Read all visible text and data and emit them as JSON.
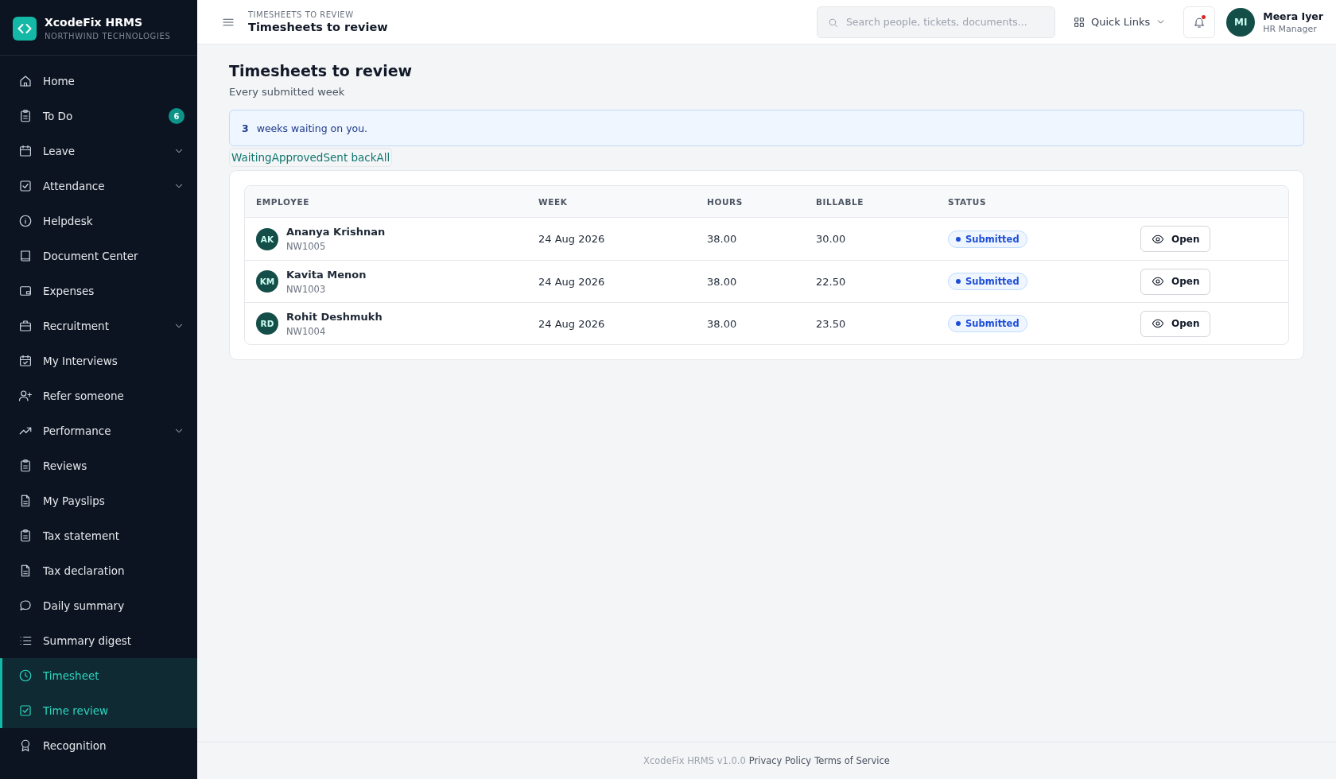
{
  "brand": {
    "name": "XcodeFix HRMS",
    "org": "NORTHWIND TECHNOLOGIES"
  },
  "sidebar": {
    "items": [
      {
        "label": "Home",
        "selected": false
      },
      {
        "label": "To Do",
        "selected": false,
        "badge": "6"
      },
      {
        "label": "Leave",
        "selected": false,
        "expandable": true
      },
      {
        "label": "Attendance",
        "selected": false,
        "expandable": true
      },
      {
        "label": "Helpdesk",
        "selected": false
      },
      {
        "label": "Document Center",
        "selected": false
      },
      {
        "label": "Expenses",
        "selected": false
      },
      {
        "label": "Recruitment",
        "selected": false,
        "expandable": true
      },
      {
        "label": "My Interviews",
        "selected": false
      },
      {
        "label": "Refer someone",
        "selected": false
      },
      {
        "label": "Performance",
        "selected": false,
        "expandable": true
      },
      {
        "label": "Reviews",
        "selected": false
      },
      {
        "label": "My Payslips",
        "selected": false
      },
      {
        "label": "Tax statement",
        "selected": false
      },
      {
        "label": "Tax declaration",
        "selected": false
      },
      {
        "label": "Daily summary",
        "selected": false
      },
      {
        "label": "Summary digest",
        "selected": false
      },
      {
        "label": "Timesheet",
        "selected": true
      },
      {
        "label": "Time review",
        "selected": true
      },
      {
        "label": "Recognition",
        "selected": false
      }
    ]
  },
  "header": {
    "breadcrumb": "TIMESHEETS TO REVIEW",
    "title": "Timesheets to review",
    "search": {
      "placeholder": "Search people, tickets, documents..."
    },
    "quick_links": "Quick Links",
    "notification_dot": true,
    "user": {
      "initials": "MI",
      "name": "Meera Iyer",
      "role": "HR Manager"
    }
  },
  "page": {
    "title": "Timesheets to review",
    "subtitle": "Every submitted week",
    "alert": {
      "count": "3",
      "text": "weeks waiting on you."
    },
    "filters": [
      {
        "label": "Waiting",
        "selected": false
      },
      {
        "label": "Approved",
        "selected": false
      },
      {
        "label": "Sent back",
        "selected": false
      },
      {
        "label": "All",
        "selected": false
      }
    ]
  },
  "table": {
    "columns": [
      "EMPLOYEE",
      "WEEK",
      "HOURS",
      "BILLABLE",
      "STATUS"
    ],
    "rows": [
      {
        "initials": "AK",
        "name": "Ananya Krishnan",
        "id": "NW1005",
        "week": "24 Aug 2026",
        "hours": "38.00",
        "billable": "30.00",
        "status": "Submitted",
        "action": "Open"
      },
      {
        "initials": "KM",
        "name": "Kavita Menon",
        "id": "NW1003",
        "week": "24 Aug 2026",
        "hours": "38.00",
        "billable": "22.50",
        "status": "Submitted",
        "action": "Open"
      },
      {
        "initials": "RD",
        "name": "Rohit Deshmukh",
        "id": "NW1004",
        "week": "24 Aug 2026",
        "hours": "38.00",
        "billable": "23.50",
        "status": "Submitted",
        "action": "Open"
      }
    ]
  },
  "footer": {
    "version": "XcodeFix HRMS v1.0.0",
    "links": [
      "Privacy Policy",
      "Terms of Service"
    ]
  }
}
